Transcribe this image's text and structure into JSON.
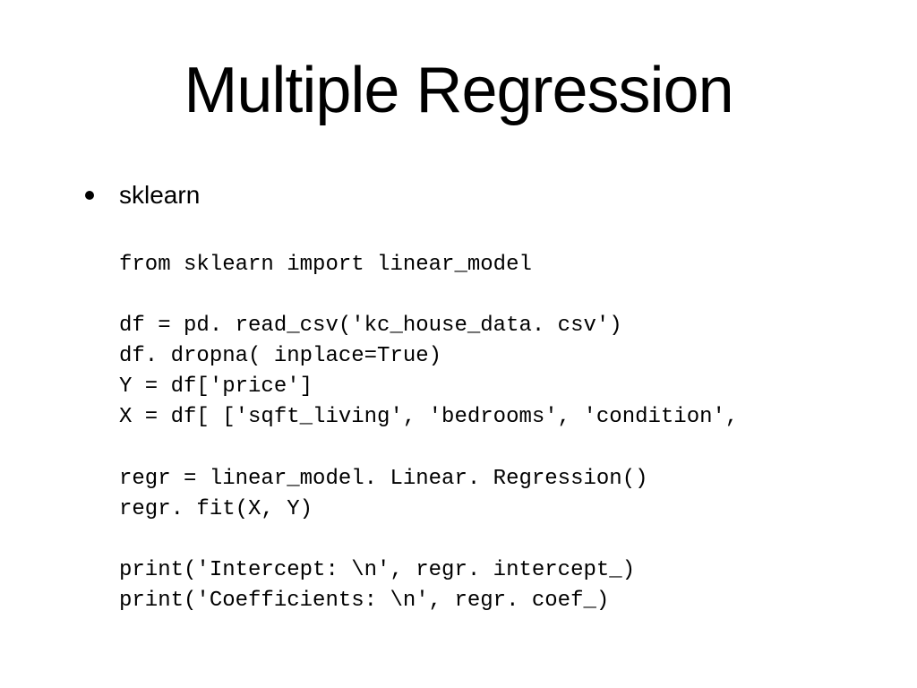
{
  "title": "Multiple Regression",
  "bullet": "sklearn",
  "code": "from sklearn import linear_model\n\ndf = pd. read_csv('kc_house_data. csv')\ndf. dropna( inplace=True)\nY = df['price']\nX = df[ ['sqft_living', 'bedrooms', 'condition',\n\nregr = linear_model. Linear. Regression()\nregr. fit(X, Y)\n\nprint('Intercept: \\n', regr. intercept_)\nprint('Coefficients: \\n', regr. coef_)"
}
